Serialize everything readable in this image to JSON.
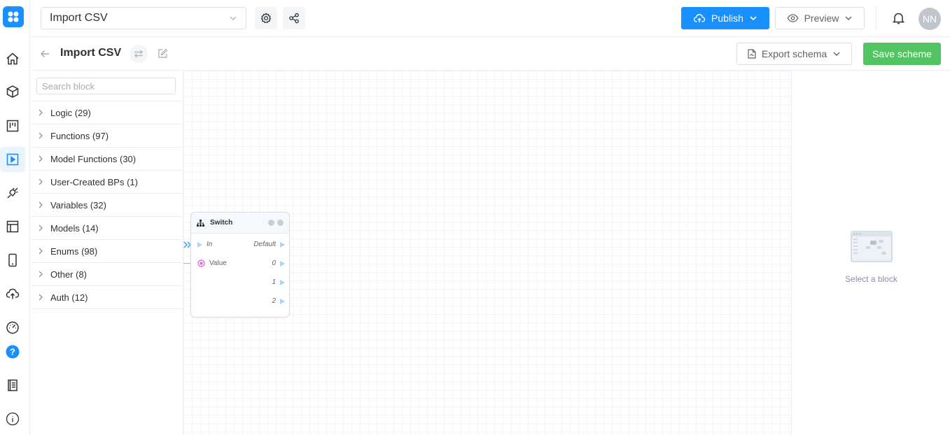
{
  "topbar": {
    "app_name": "Import CSV",
    "publish_label": "Publish",
    "preview_label": "Preview",
    "avatar_initials": "NN",
    "accent": "#1890ff"
  },
  "subheader": {
    "title": "Import CSV",
    "export_label": "Export schema",
    "save_label": "Save scheme",
    "save_color": "#52c463"
  },
  "blocks": {
    "search_placeholder": "Search block",
    "categories": [
      {
        "label": "Logic (29)"
      },
      {
        "label": "Functions (97)"
      },
      {
        "label": "Model Functions (30)"
      },
      {
        "label": "User-Created BPs (1)"
      },
      {
        "label": "Variables (32)"
      },
      {
        "label": "Models (14)"
      },
      {
        "label": "Enums (98)"
      },
      {
        "label": "Other (8)"
      },
      {
        "label": "Auth (12)"
      }
    ]
  },
  "node": {
    "title": "Switch",
    "inputs": [
      {
        "label": "In"
      },
      {
        "label": "Value"
      }
    ],
    "outputs": [
      {
        "label": "Default"
      },
      {
        "label": "0"
      },
      {
        "label": "1"
      },
      {
        "label": "2"
      }
    ]
  },
  "inspector": {
    "empty_text": "Select a block"
  },
  "rail": {
    "icons": [
      "home-icon",
      "cube-icon",
      "kanban-icon",
      "play-icon",
      "plug-icon",
      "layout-icon",
      "mobile-icon",
      "upload-cloud-icon",
      "dashboard-icon",
      "help-icon",
      "book-icon",
      "info-icon"
    ],
    "active": "play-icon"
  }
}
